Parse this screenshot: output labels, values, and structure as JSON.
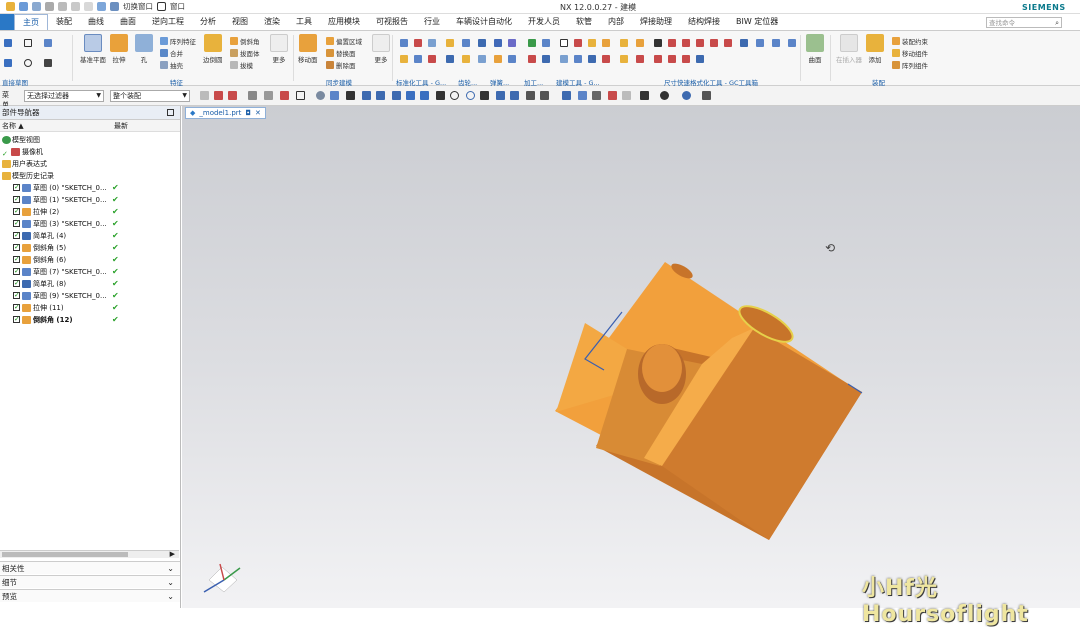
{
  "app": {
    "title": "NX 12.0.0.27 - 建模",
    "brand": "SIEMENS",
    "quick_access": {
      "switch_window": "切换窗口",
      "window": "窗口"
    }
  },
  "ribbon_tabs": [
    "主页",
    "装配",
    "曲线",
    "曲面",
    "逆向工程",
    "分析",
    "视图",
    "渲染",
    "工具",
    "应用模块",
    "可视报告",
    "行业",
    "车辆设计自动化",
    "开发人员",
    "软管",
    "内部",
    "焊接助理",
    "结构焊接",
    "BIW 定位器"
  ],
  "search_placeholder": "查找命令",
  "ribbon": {
    "groups": [
      "直接草图",
      "特征",
      "同步建模",
      "标准化工具 - G...",
      "齿轮...",
      "弹簧...",
      "加工...",
      "建模工具 - G...",
      "尺寸快速格式化工具 - GC工具箱",
      "装配"
    ],
    "buttons": {
      "datum_plane": "基准平面",
      "extrude": "拉伸",
      "hole": "孔",
      "array_feature": "阵列特征",
      "unite": "合并",
      "shell": "抽壳",
      "edge_blend": "边倒圆",
      "chamfer": "倒斜角",
      "draft": "拔模",
      "thicken": "拔面体",
      "more1": "更多",
      "move_face": "移动面",
      "offset_region": "偏置区域",
      "replace_face": "替换面",
      "delete_face": "删除面",
      "more2": "更多",
      "surface": "曲面",
      "assembly_constraint": "装配约束",
      "move_component": "移动组件",
      "array_component": "阵列组件",
      "add": "添加",
      "component_dialog": "在插入器"
    }
  },
  "selection_bar": {
    "menu": "菜单",
    "filter": "无选择过滤器",
    "scope": "整个装配"
  },
  "navigator": {
    "title": "部件导航器",
    "col_name": "名称",
    "col_latest": "最新",
    "rows": [
      {
        "label": "模型视图",
        "check": false
      },
      {
        "label": "摄像机",
        "check": true
      },
      {
        "label": "用户表达式",
        "check": false
      },
      {
        "label": "模型历史记录",
        "check": false
      },
      {
        "label": "草图 (0) \"SKETCH_0...",
        "check": true
      },
      {
        "label": "草图 (1) \"SKETCH_0...",
        "check": true
      },
      {
        "label": "拉伸 (2)",
        "check": true
      },
      {
        "label": "草图 (3) \"SKETCH_0...",
        "check": true
      },
      {
        "label": "简单孔 (4)",
        "check": true
      },
      {
        "label": "倒斜角 (5)",
        "check": true
      },
      {
        "label": "倒斜角 (6)",
        "check": true
      },
      {
        "label": "草图 (7) \"SKETCH_0...",
        "check": true
      },
      {
        "label": "简单孔 (8)",
        "check": true
      },
      {
        "label": "草图 (9) \"SKETCH_0...",
        "check": true
      },
      {
        "label": "拉伸 (11)",
        "check": true
      },
      {
        "label": "倒斜角 (12)",
        "check": true
      }
    ],
    "accordion": [
      "相关性",
      "细节",
      "预览"
    ]
  },
  "viewport": {
    "tab": "_model1.prt",
    "tab_pin": "◘",
    "tab_close": "✕",
    "watermark": "小Hf光Hoursoflight"
  },
  "colors": {
    "accent": "#2a78c6",
    "part": "#f2a03c",
    "part_dark": "#c7742a",
    "edge": "#3a5fb0"
  }
}
